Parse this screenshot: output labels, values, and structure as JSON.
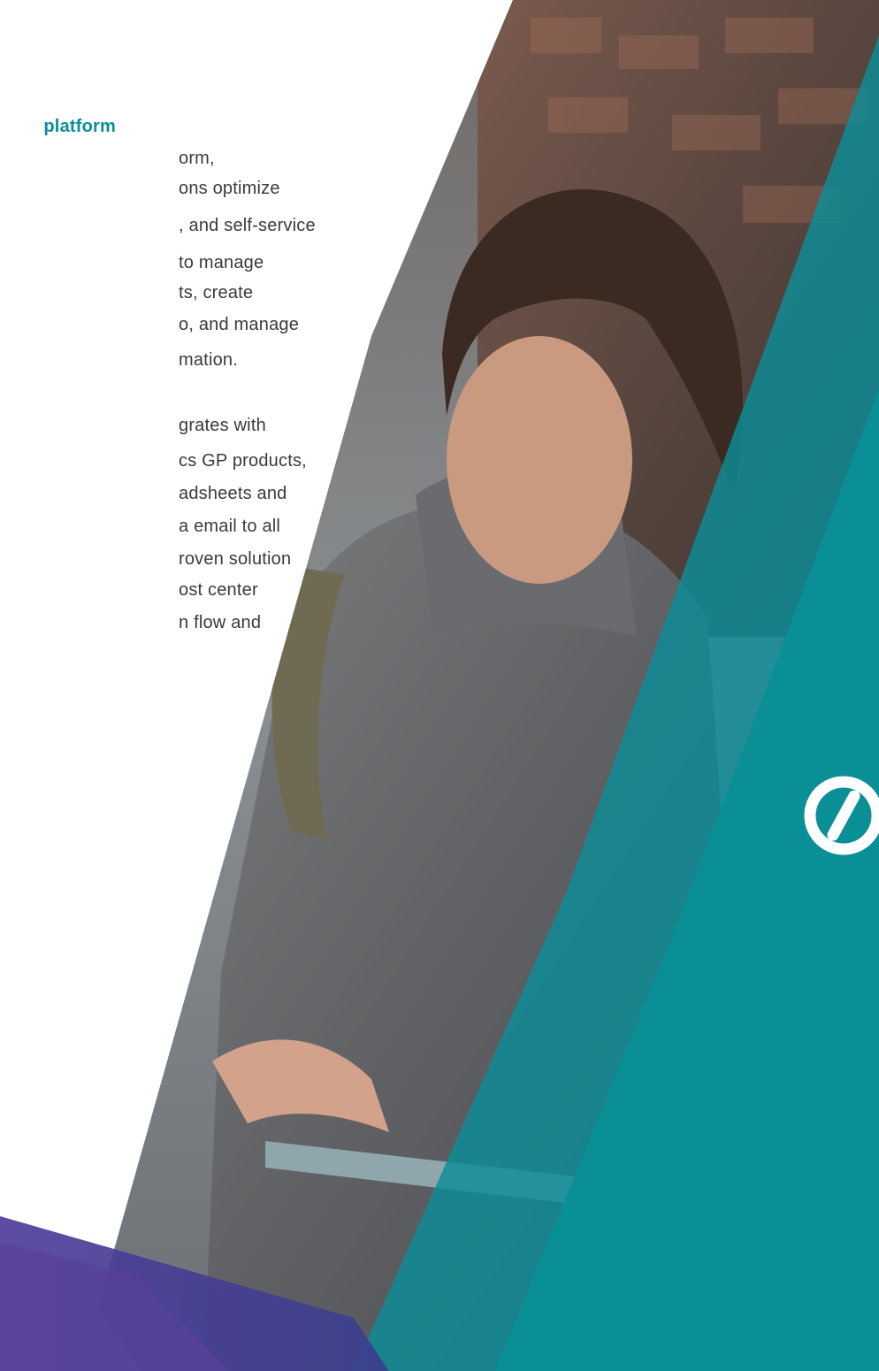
{
  "copy": {
    "heading": "platform",
    "paragraph1": [
      "orm,",
      "ons optimize",
      ", and self-service",
      "to manage",
      "ts, create",
      "o, and manage",
      "mation."
    ],
    "paragraph2": [
      "grates with",
      "cs GP products,",
      "adsheets and",
      "a email to all",
      "roven solution",
      "ost center",
      "n flow and"
    ]
  },
  "colors": {
    "heading": "#0a8f99",
    "body_text": "#3a3a3a",
    "teal_panel": "#0c8e98",
    "teal_light": "#27a9b0",
    "purple_band": "#5a3f9a",
    "logo": "#ffffff"
  },
  "images": {
    "photo": "man-in-grey-sweater-with-tablet",
    "logo": "brand-e-logo-icon"
  }
}
